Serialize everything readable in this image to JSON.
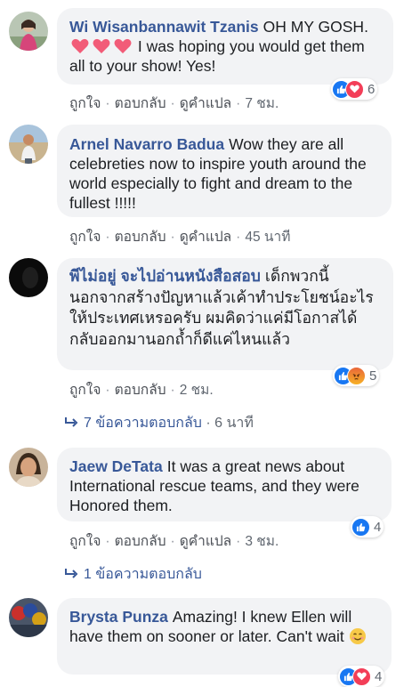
{
  "comments": [
    {
      "author": "Wi Wisanbannawit Tzanis",
      "text_before": "OH MY GOSH.",
      "text_after": "I was hoping you would get them all to your show! Yes!",
      "actions": [
        "ถูกใจ",
        "ตอบกลับ",
        "ดูคำแปล"
      ],
      "time": "7 ชม.",
      "reaction_count": "6",
      "reaction_icons": [
        "like-icon",
        "love-icon"
      ]
    },
    {
      "author": "Arnel Navarro Badua",
      "text": "Wow they are all celebreties now to inspire youth around the world especially to fight and dream to the fullest !!!!!",
      "actions": [
        "ถูกใจ",
        "ตอบกลับ",
        "ดูคำแปล"
      ],
      "time": "45 นาที"
    },
    {
      "author": "พีไม่อยู่ จะไปอ่านหนังสือสอบ",
      "text": "เด็กพวกนี้นอกจากสร้างปัญหาแล้วเค้าทำประโยชน์อะไรให้ประเทศเหรอครับ ผมคิดว่าแค่มีโอกาสได้กลับออกมานอกถ้ำก็ดีแค่ไหนแล้ว",
      "actions": [
        "ถูกใจ",
        "ตอบกลับ"
      ],
      "time": "2 ชม.",
      "reaction_count": "5",
      "reaction_icons": [
        "like-icon",
        "angry-icon"
      ],
      "replies_label": "7 ข้อความตอบกลับ",
      "replies_time": "6 นาที"
    },
    {
      "author": "Jaew DeTata",
      "text": "It was a great news about International rescue teams, and they were Honored them.",
      "actions": [
        "ถูกใจ",
        "ตอบกลับ",
        "ดูคำแปล"
      ],
      "time": "3 ชม.",
      "reaction_count": "4",
      "reaction_icons": [
        "like-icon"
      ],
      "replies_label": "1 ข้อความตอบกลับ"
    },
    {
      "author": "Brysta Punza",
      "text": "Amazing! I knew Ellen will have them on sooner or later. Can't wait",
      "reaction_count": "4",
      "reaction_icons": [
        "like-icon",
        "love-icon"
      ]
    }
  ],
  "colors": {
    "author": "#385898",
    "bubble": "#f2f3f5",
    "meta": "#606770",
    "like": "#1877f2",
    "love": "#f33e58",
    "angry": "#f7b125"
  }
}
